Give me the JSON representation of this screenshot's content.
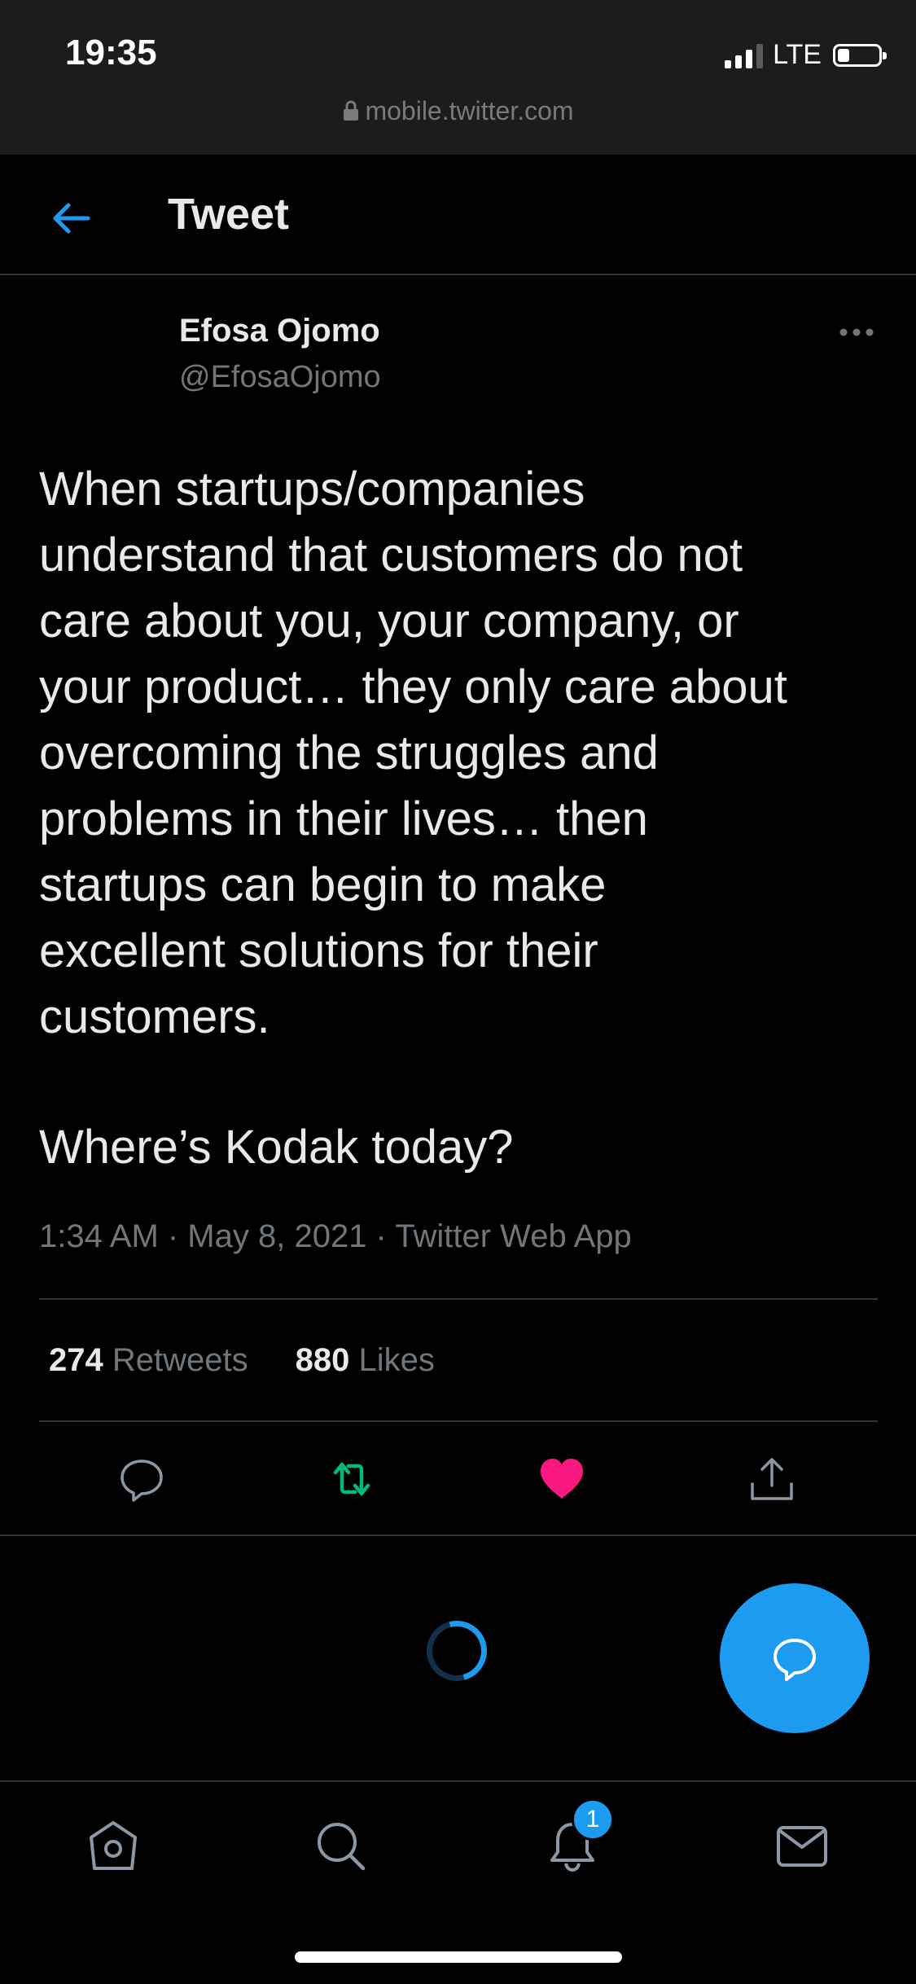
{
  "status": {
    "time": "19:35",
    "network": "LTE"
  },
  "browser": {
    "url": "mobile.twitter.com"
  },
  "header": {
    "title": "Tweet"
  },
  "tweet": {
    "author_name": "Efosa Ojomo",
    "author_handle": "@EfosaOjomo",
    "text": "When startups/companies\nunderstand that customers do not\ncare about you, your company, or\nyour product… they only care about\novercoming the struggles and\nproblems in their lives… then\nstartups can begin to make\nexcellent solutions for their\ncustomers.",
    "text2": "Where’s Kodak today?",
    "meta": "1:34 AM · May 8, 2021 · Twitter Web App",
    "retweets_count": "274",
    "retweets_label": "Retweets",
    "likes_count": "880",
    "likes_label": "Likes",
    "liked": true
  },
  "actions": [
    "reply-icon",
    "retweet-icon",
    "like-icon",
    "share-icon"
  ],
  "tabbar": {
    "items": [
      "home-icon",
      "search-icon",
      "notifications-icon",
      "messages-icon"
    ],
    "notification_badge": "1"
  },
  "colors": {
    "accent": "#1d9bf0",
    "retweet": "#00ba7c",
    "like": "#f91880",
    "background": "#000000"
  }
}
